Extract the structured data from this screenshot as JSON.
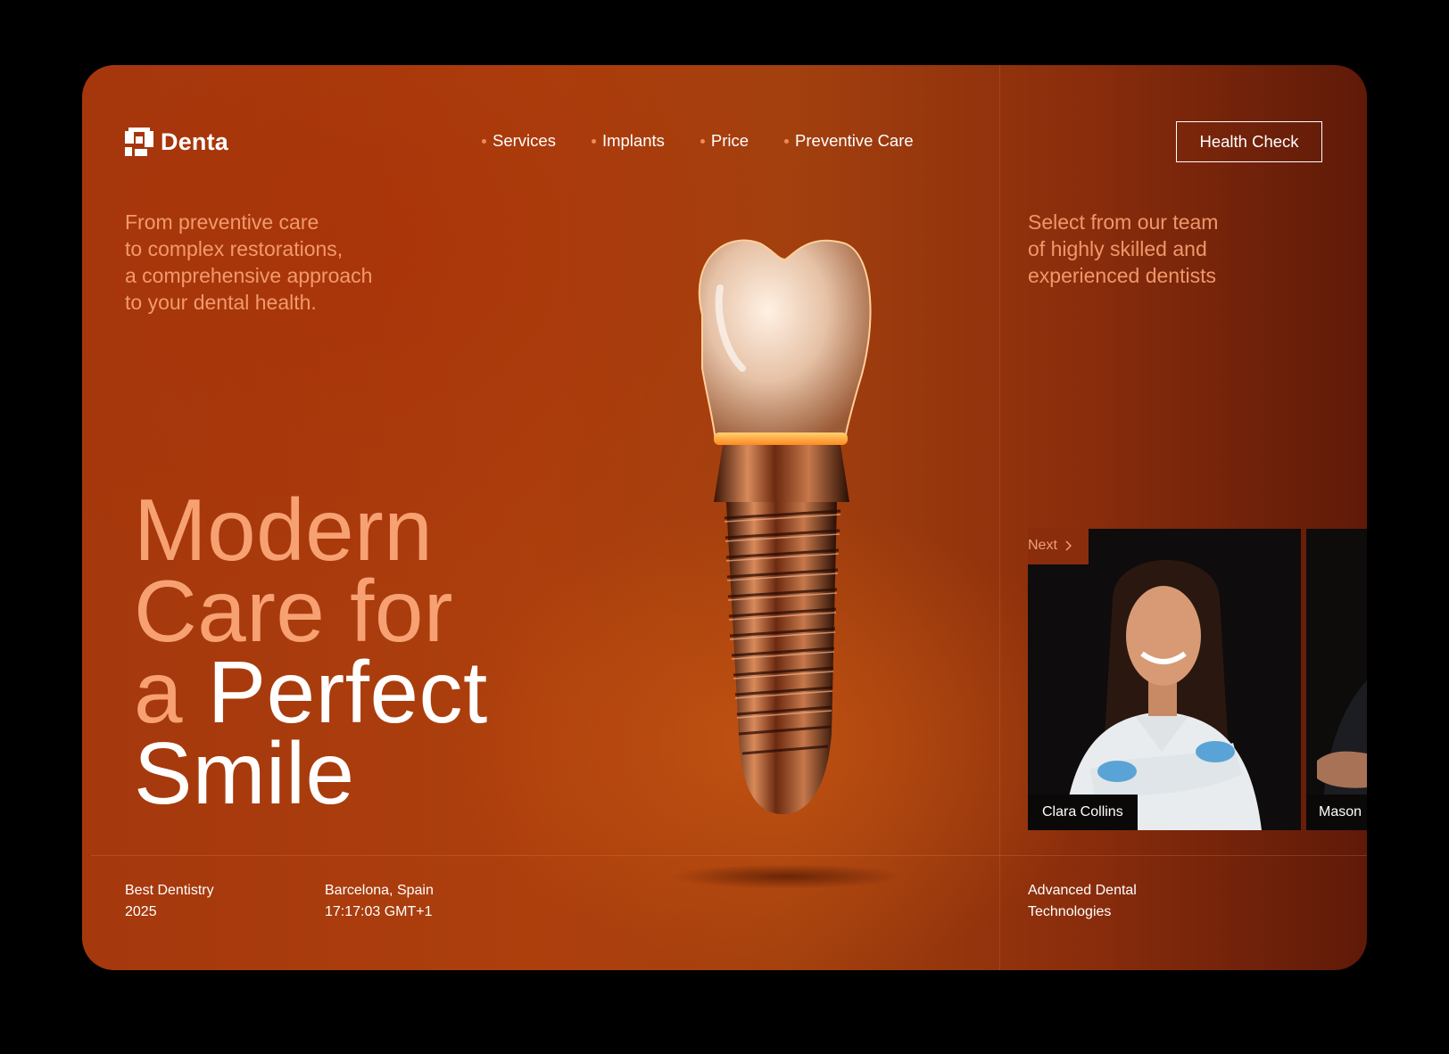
{
  "brand": {
    "name": "Denta"
  },
  "nav": {
    "items": [
      {
        "label": "Services"
      },
      {
        "label": "Implants"
      },
      {
        "label": "Price"
      },
      {
        "label": "Preventive Care"
      }
    ],
    "cta_label": "Health Check"
  },
  "intro": {
    "left": [
      "From preventive care",
      "to complex restorations,",
      "a comprehensive approach",
      "to your dental health."
    ],
    "right": [
      "Select from our team",
      "of highly skilled and",
      "experienced dentists"
    ]
  },
  "headline": {
    "line1": "Modern",
    "line2": "Care for",
    "line3_accent": "a",
    "line3_white": "Perfect",
    "line4": "Smile"
  },
  "team": {
    "next_label": "Next",
    "members": [
      {
        "name": "Clara Collins"
      },
      {
        "name": "Mason"
      }
    ]
  },
  "footer": {
    "award": [
      "Best Dentistry",
      "2025"
    ],
    "location": [
      "Barcelona, Spain",
      "17:17:03 GMT+1"
    ],
    "tagline": [
      "Advanced Dental",
      "Technologies"
    ]
  },
  "colors": {
    "accent": "#f7a172",
    "background": "#a5380d",
    "dark_panel": "#5f1a08"
  },
  "icons": {
    "logo": "denta-logo-icon",
    "next": "chevron-right-icon"
  }
}
